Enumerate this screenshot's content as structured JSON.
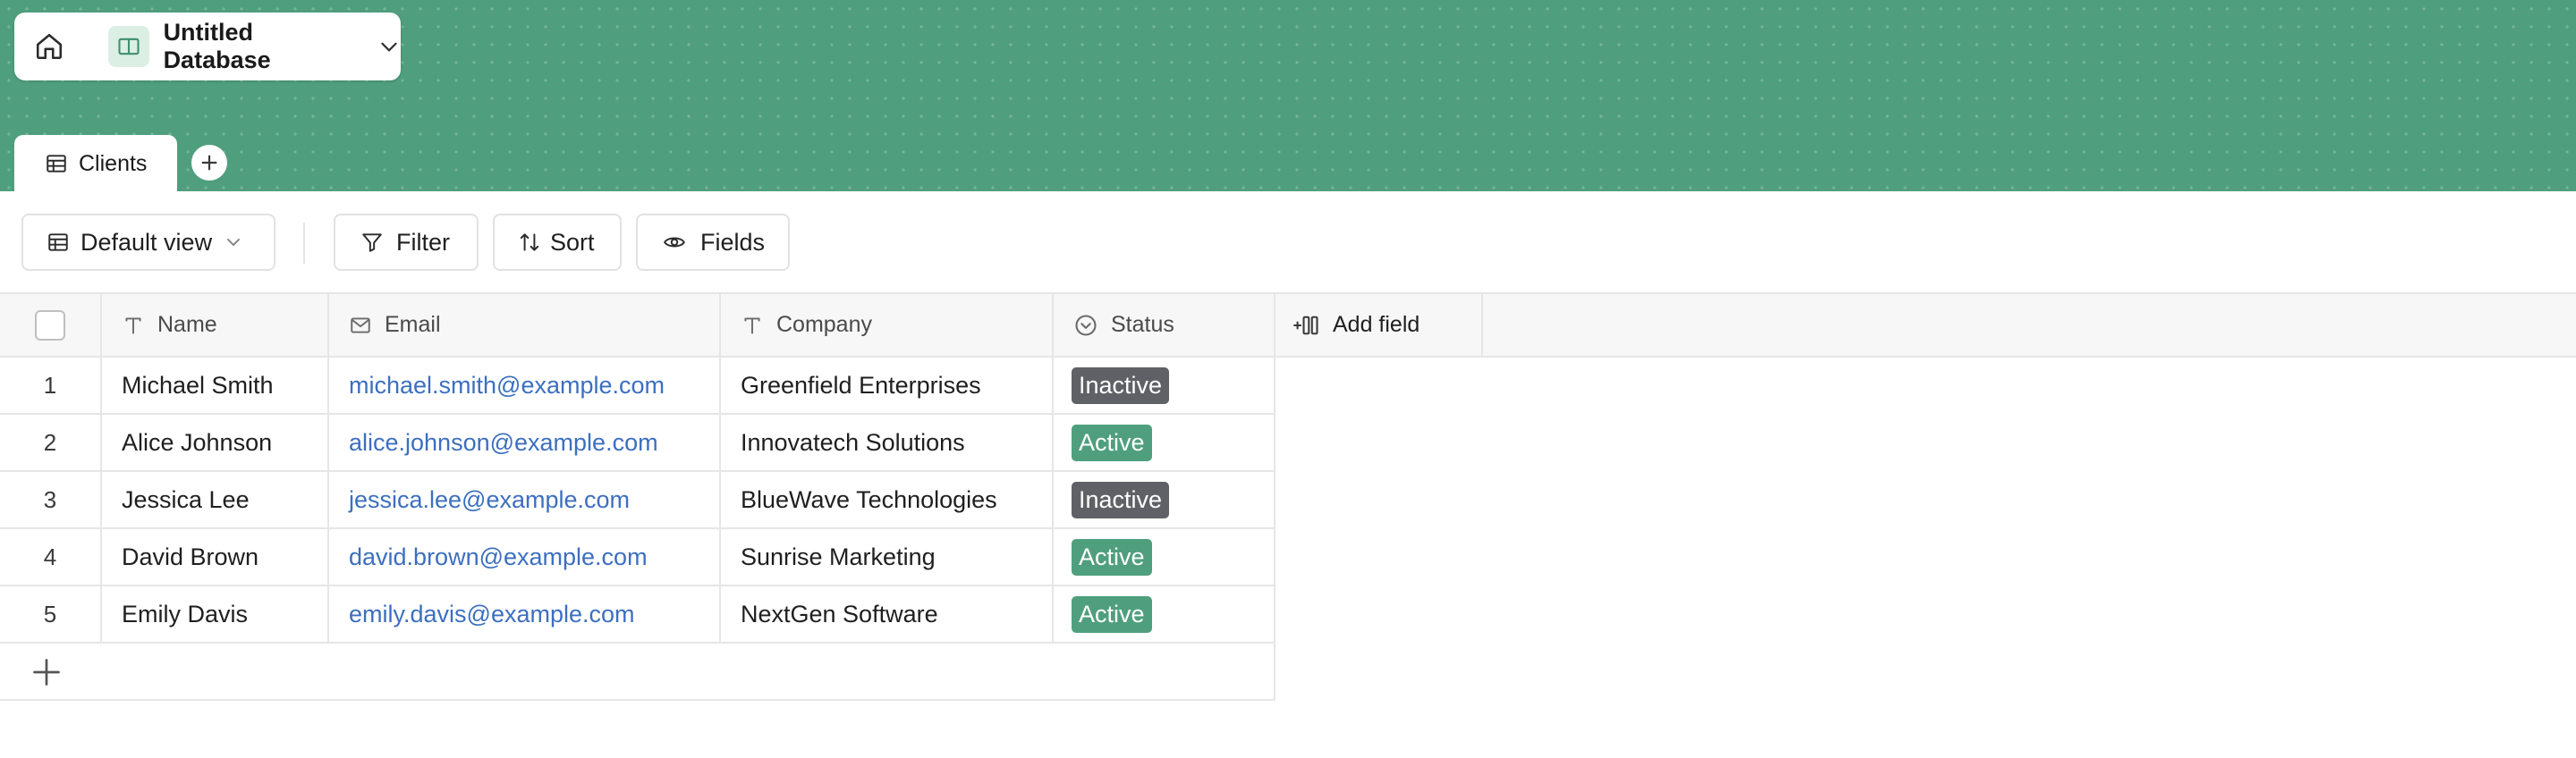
{
  "database": {
    "title": "Untitled Database"
  },
  "tabs": [
    {
      "label": "Clients"
    }
  ],
  "toolbar": {
    "view_label": "Default view",
    "filter_label": "Filter",
    "sort_label": "Sort",
    "fields_label": "Fields"
  },
  "columns": [
    {
      "label": "Name",
      "icon": "text-type-icon"
    },
    {
      "label": "Email",
      "icon": "mail-icon"
    },
    {
      "label": "Company",
      "icon": "text-type-icon"
    },
    {
      "label": "Status",
      "icon": "circle-chevron-icon"
    }
  ],
  "add_field_label": "Add field",
  "rows": [
    {
      "index": "1",
      "name": "Michael Smith",
      "email": "michael.smith@example.com",
      "company": "Greenfield Enterprises",
      "status": "Inactive"
    },
    {
      "index": "2",
      "name": "Alice Johnson",
      "email": "alice.johnson@example.com",
      "company": "Innovatech Solutions",
      "status": "Active"
    },
    {
      "index": "3",
      "name": "Jessica Lee",
      "email": "jessica.lee@example.com",
      "company": "BlueWave Technologies",
      "status": "Inactive"
    },
    {
      "index": "4",
      "name": "David Brown",
      "email": "david.brown@example.com",
      "company": "Sunrise Marketing",
      "status": "Active"
    },
    {
      "index": "5",
      "name": "Emily Davis",
      "email": "emily.davis@example.com",
      "company": "NextGen Software",
      "status": "Active"
    }
  ],
  "colors": {
    "header_green": "#4f9f7e",
    "active_badge": "#4f9f7e",
    "inactive_badge": "#5f6166",
    "link_blue": "#3c6fbf"
  }
}
